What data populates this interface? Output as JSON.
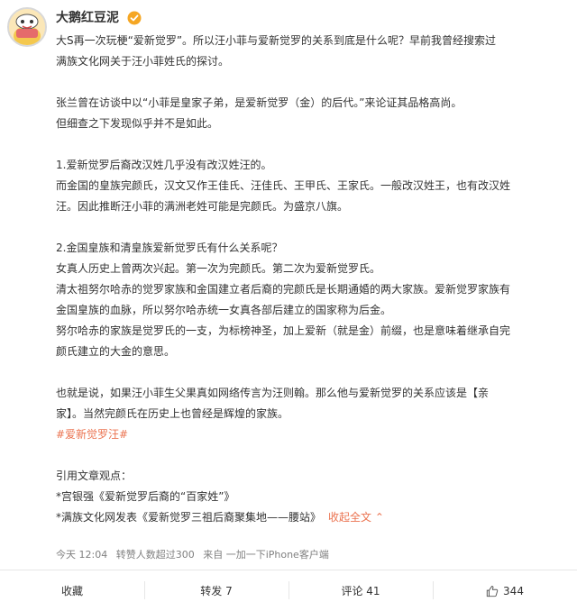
{
  "user": {
    "name": "大鹅红豆泥"
  },
  "post": {
    "lines": [
      "大S再一次玩梗“爱新觉罗”。所以汪小菲与爱新觉罗的关系到底是什么呢？早前我曾经搜索过",
      "满族文化网关于汪小菲姓氏的探讨。",
      "",
      "张兰曾在访谈中以“小菲是皇家子弟，是爱新觉罗（金）的后代。”来论证其品格高尚。",
      "但细查之下发现似乎并不是如此。",
      "",
      "1.爱新觉罗后裔改汉姓几乎没有改汉姓汪的。",
      "而金国的皇族完颜氏，汉文又作王佳氏、汪佳氏、王甲氏、王家氏。一般改汉姓王，也有改汉姓",
      "汪。因此推断汪小菲的满洲老姓可能是完颜氏。为盛京八旗。",
      "",
      "2.金国皇族和清皇族爱新觉罗氏有什么关系呢？",
      "女真人历史上曾两次兴起。第一次为完颜氏。第二次为爱新觉罗氏。",
      "清太祖努尔哈赤的觉罗家族和金国建立者后裔的完颜氏是长期通婚的两大家族。爱新觉罗家族有",
      "金国皇族的血脉，所以努尔哈赤统一女真各部后建立的国家称为后金。",
      "努尔哈赤的家族是觉罗氏的一支，为标榜神圣，加上爱新（就是金）前缀，也是意味着继承自完",
      "颜氏建立的大金的意思。",
      "",
      "也就是说，如果汪小菲生父果真如网络传言为汪则翰。那么他与爱新觉罗的关系应该是【亲",
      "家】。当然完颜氏在历史上也曾经是辉煌的家族。"
    ],
    "hashtag": "#爱新觉罗汪#",
    "refs_title": "引用文章观点：",
    "ref1": "*宫银强《爱新觉罗后裔的“百家姓”》",
    "ref2": "*满族文化网发表《爱新觉罗三祖后裔聚集地——腰站》",
    "collapse_label": "收起全文",
    "collapse_arrow": "⌃"
  },
  "meta": {
    "time": "今天 12:04",
    "reads": "转赞人数超过300",
    "source": "来自 一加一下iPhone客户端"
  },
  "actions": {
    "favorite": "收藏",
    "repost": "转发 7",
    "comment": "评论 41",
    "like": "344"
  },
  "colors": {
    "accent": "#eb7350",
    "verified": "#f5a623",
    "text": "#333333",
    "meta": "#808080"
  }
}
